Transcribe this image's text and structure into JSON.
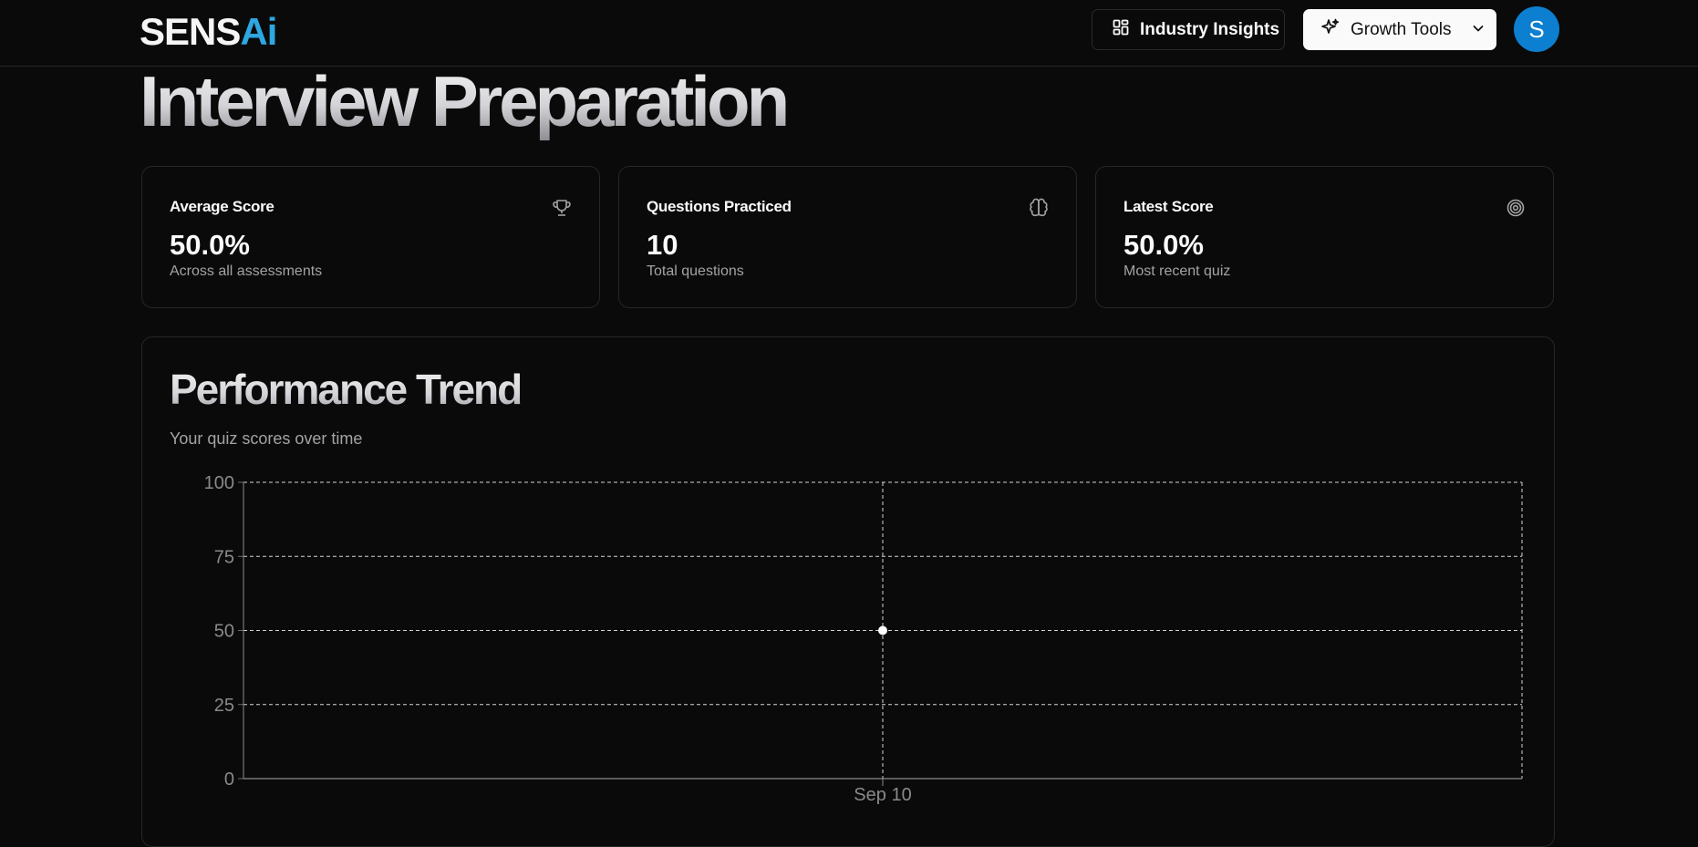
{
  "header": {
    "logo_text": "SENS",
    "logo_accent": "Ai",
    "industry_insights_label": "Industry Insights",
    "growth_tools_label": "Growth Tools",
    "avatar_initial": "S"
  },
  "page": {
    "title": "Interview Preparation"
  },
  "stats": [
    {
      "label": "Average Score",
      "value": "50.0%",
      "sub": "Across all assessments",
      "icon": "trophy-icon"
    },
    {
      "label": "Questions Practiced",
      "value": "10",
      "sub": "Total questions",
      "icon": "brain-icon"
    },
    {
      "label": "Latest Score",
      "value": "50.0%",
      "sub": "Most recent quiz",
      "icon": "target-icon"
    }
  ],
  "performance": {
    "title": "Performance Trend",
    "subtitle": "Your quiz scores over time"
  },
  "colors": {
    "background": "#0a0a0a",
    "border": "#262626",
    "accent": "#0c7fd0",
    "logo_accent": "#2ea6e0",
    "grid": "#d4d4d4",
    "point": "#ffffff"
  },
  "chart_data": {
    "type": "line",
    "x": [
      "Sep 10"
    ],
    "series": [
      {
        "values": [
          50
        ]
      }
    ],
    "yticks": [
      0,
      25,
      50,
      75,
      100
    ],
    "ylim": [
      0,
      100
    ],
    "xlabel": "",
    "ylabel": "",
    "grid": true,
    "title": "",
    "legend": "none"
  }
}
